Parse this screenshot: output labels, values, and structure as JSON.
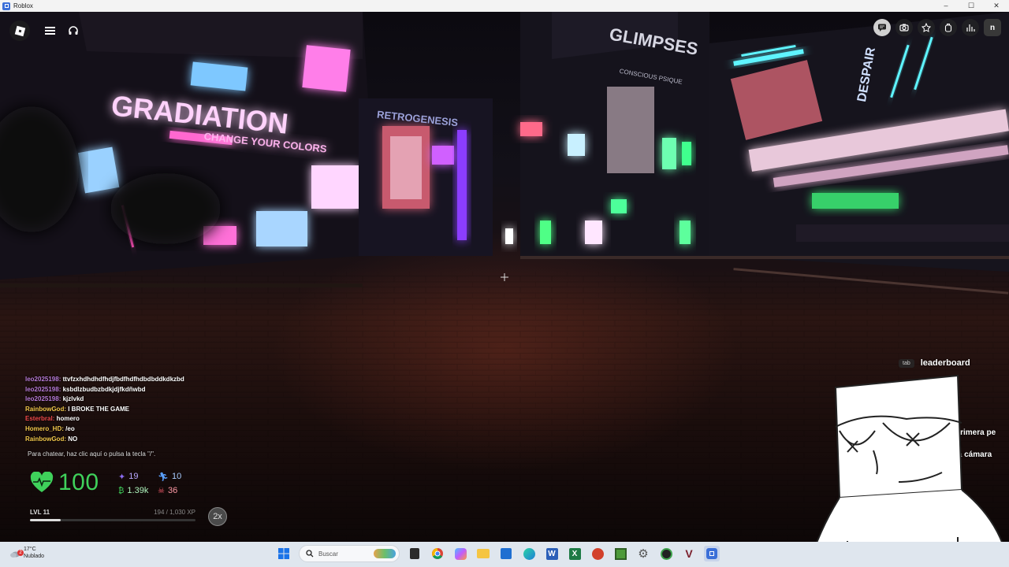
{
  "window": {
    "title": "Roblox",
    "controls": [
      "–",
      "☐",
      "✕"
    ]
  },
  "scene": {
    "signs": {
      "gradiation": "GRADIATION",
      "gradiation_sub": "CHANGE YOUR COLORS",
      "retro": "RETROGENESIS",
      "glimpses": "GLIMPSES",
      "glimpses_sub": "CONSCIOUS PSIQUE",
      "despair": "DESPAIR"
    }
  },
  "topbar_right": {
    "icons": [
      "chat-icon",
      "camera-icon",
      "emote-icon",
      "backpack-icon",
      "stats-icon"
    ],
    "user_initial": "n"
  },
  "chat": {
    "messages": [
      {
        "user": "leo2025198:",
        "text": "ttvfzxhdhdhdfhdjfbdfhdfhdbdbddkdkzbd",
        "color": "#b57ad6"
      },
      {
        "user": "leo2025198:",
        "text": "ksbdlzbudbzbdkjdjfkdñwbd",
        "color": "#b57ad6"
      },
      {
        "user": "leo2025198:",
        "text": "kjzlvkd",
        "color": "#b57ad6"
      },
      {
        "user": "RainbowGod:",
        "text": "I BROKE THE GAME",
        "color": "#f2c84b"
      },
      {
        "user": "Esterbral:",
        "text": "homero",
        "color": "#f04a4a"
      },
      {
        "user": "Homero_HD:",
        "text": "/eo",
        "color": "#f2c84b"
      },
      {
        "user": "RainbowGod:",
        "text": "NO",
        "color": "#f2c84b"
      }
    ],
    "hint": "Para chatear, haz clic aquí o pulsa la tecla \"/\"."
  },
  "hud": {
    "health": "100",
    "stats": {
      "gems": "19",
      "speed": "10",
      "coins": "1.39k",
      "kills": "36"
    },
    "level_label": "LVL 11",
    "xp_text": "194 / 1,030 XP",
    "xp_fraction": 0.188,
    "multiplier": "2x",
    "colors": {
      "health": "#3fd15b",
      "gem": "#8a6cf0",
      "speed": "#5aa0ff",
      "coin": "#3fd15b",
      "kill": "#f05a6a"
    }
  },
  "leaderboard": {
    "key": "tab",
    "label": "leaderboard"
  },
  "side_texts": {
    "first_person": "primera pe",
    "camera": "la cámara"
  },
  "taskbar": {
    "weather_temp": "17°C",
    "weather_desc": "Nublado",
    "notification_count": "2",
    "search_placeholder": "Buscar",
    "apps": [
      "start-icon",
      "search",
      "widgets-icon",
      "file-explorer-icon",
      "chrome-icon",
      "copilot-icon",
      "folder-icon",
      "store-icon",
      "edge-icon",
      "word-icon",
      "excel-icon",
      "office-icon",
      "minecraft-icon",
      "settings-icon",
      "xbox-icon",
      "games-icon",
      "roblox-icon"
    ]
  }
}
